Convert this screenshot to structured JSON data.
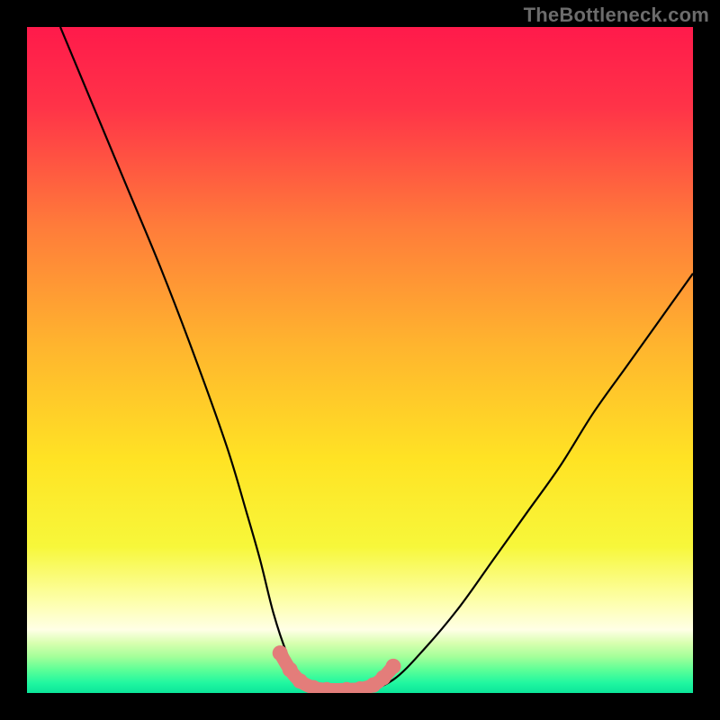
{
  "watermark": "TheBottleneck.com",
  "chart_data": {
    "type": "line",
    "title": "",
    "xlabel": "",
    "ylabel": "",
    "xlim": [
      0,
      100
    ],
    "ylim": [
      0,
      100
    ],
    "series": [
      {
        "name": "bottleneck-curve",
        "x": [
          5,
          10,
          15,
          20,
          25,
          30,
          33,
          35,
          37,
          39,
          41,
          43,
          45,
          50,
          55,
          60,
          65,
          70,
          75,
          80,
          85,
          90,
          95,
          100
        ],
        "values": [
          100,
          88,
          76,
          64,
          51,
          37,
          27,
          20,
          12,
          6,
          2,
          0,
          0,
          0,
          2,
          7,
          13,
          20,
          27,
          34,
          42,
          49,
          56,
          63
        ]
      },
      {
        "name": "marker-segment",
        "x": [
          38,
          39.5,
          41,
          43,
          45,
          48,
          50,
          52,
          53.5,
          55
        ],
        "values": [
          6,
          3.5,
          1.8,
          0.8,
          0.5,
          0.5,
          0.6,
          1.2,
          2.3,
          4
        ]
      }
    ],
    "gradient_stops": [
      {
        "pos": 0.0,
        "color": "#ff1a4b"
      },
      {
        "pos": 0.12,
        "color": "#ff3348"
      },
      {
        "pos": 0.3,
        "color": "#ff7c3a"
      },
      {
        "pos": 0.48,
        "color": "#ffb52e"
      },
      {
        "pos": 0.65,
        "color": "#ffe324"
      },
      {
        "pos": 0.78,
        "color": "#f7f73a"
      },
      {
        "pos": 0.86,
        "color": "#fdffa8"
      },
      {
        "pos": 0.905,
        "color": "#ffffe6"
      },
      {
        "pos": 0.925,
        "color": "#d8ffb0"
      },
      {
        "pos": 0.945,
        "color": "#a6ff9a"
      },
      {
        "pos": 0.965,
        "color": "#5dff97"
      },
      {
        "pos": 0.985,
        "color": "#20f7a0"
      },
      {
        "pos": 1.0,
        "color": "#0be59a"
      }
    ],
    "marker_color": "#e37d7a",
    "curve_color": "#000000"
  }
}
